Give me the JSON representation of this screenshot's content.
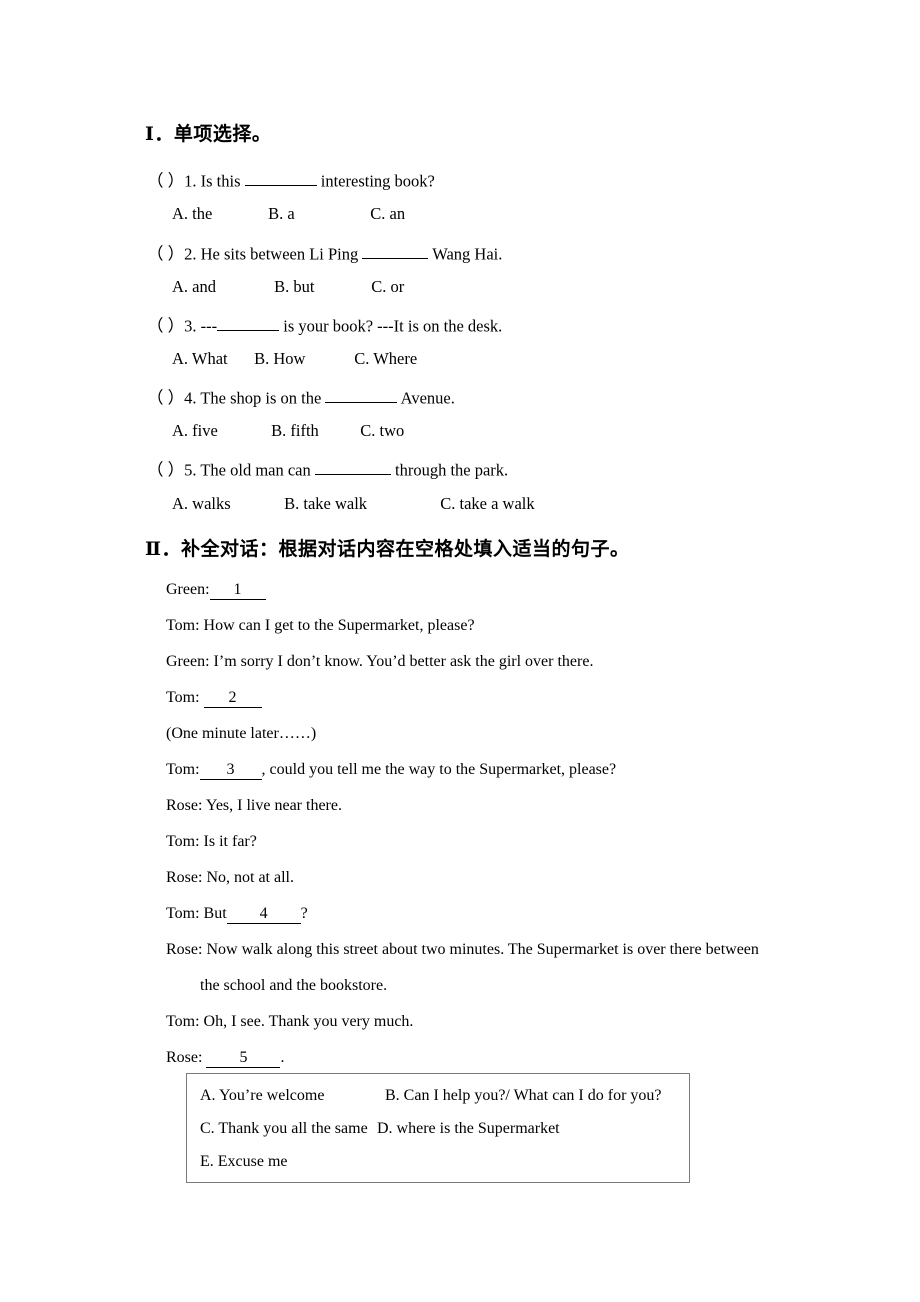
{
  "document": {
    "sections": [
      {
        "id": "section-1",
        "heading": "Ⅰ．单项选择。",
        "questions": [
          {
            "marker": "（    ）",
            "number": "1.",
            "stem_before": "Is this",
            "stem_after": "interesting book?",
            "options": [
              "A. the",
              "B. a",
              "C. an"
            ]
          },
          {
            "marker": "（    ）",
            "number": "2.",
            "stem_before": "He sits between Li Ping",
            "stem_after": "Wang Hai.",
            "options": [
              "A. and",
              "B. but",
              "C. or"
            ]
          },
          {
            "marker": "（    ）",
            "number": "3.",
            "stem_before": "---",
            "stem_after": "is your book?     ---It is on the desk.",
            "options": [
              "A. What",
              "B. How",
              "C. Where"
            ]
          },
          {
            "marker": "（    ）",
            "number": "4.",
            "stem_before": "The shop is on the",
            "stem_after": "Avenue.",
            "options": [
              "A. five",
              "B. fifth",
              "C. two"
            ]
          },
          {
            "marker": "（    ）",
            "number": "5.",
            "stem_before": "The old man can",
            "stem_after": "through the park.",
            "options": [
              "A. walks",
              "B. take walk",
              "C. take a walk"
            ]
          }
        ]
      },
      {
        "id": "section-2",
        "heading": "Ⅱ．补全对话：根据对话内容在空格处填入适当的句子。",
        "dialogue": [
          {
            "speaker": "Green:",
            "blank": "1",
            "after": ""
          },
          {
            "speaker": "Tom:",
            "text": "How can I get to the Supermarket, please?"
          },
          {
            "speaker": "Green:",
            "text": "I’m sorry I don’t know. You’d better ask the girl over there."
          },
          {
            "speaker": "Tom:",
            "blank": "2",
            "after": ""
          },
          {
            "speaker": "",
            "text": "(One minute later……)"
          },
          {
            "speaker": "Tom:",
            "blank": "3",
            "after": ", could you tell me the way to the Supermarket, please?"
          },
          {
            "speaker": "Rose:",
            "text": "Yes, I live near there."
          },
          {
            "speaker": "Tom:",
            "text": "Is it far?"
          },
          {
            "speaker": "Rose:",
            "text": "No, not at all."
          },
          {
            "speaker": "Tom:",
            "before": "But",
            "blank": "4",
            "after": "?"
          },
          {
            "speaker": "Rose:",
            "text": "Now walk along this street about two minutes. The Supermarket is over there between"
          },
          {
            "speaker": "",
            "text": "the school and the bookstore.",
            "wrapped": true
          },
          {
            "speaker": "Tom:",
            "text": "Oh, I see. Thank you very much."
          },
          {
            "speaker": "Rose:",
            "blank": "5",
            "after": "."
          }
        ],
        "options_box": {
          "a": "A. You’re welcome",
          "b": "B. Can I help you?/ What can I do for you?",
          "c": "C. Thank you all the same",
          "d": "D. where is the Supermarket",
          "e": "E. Excuse me"
        }
      }
    ]
  }
}
